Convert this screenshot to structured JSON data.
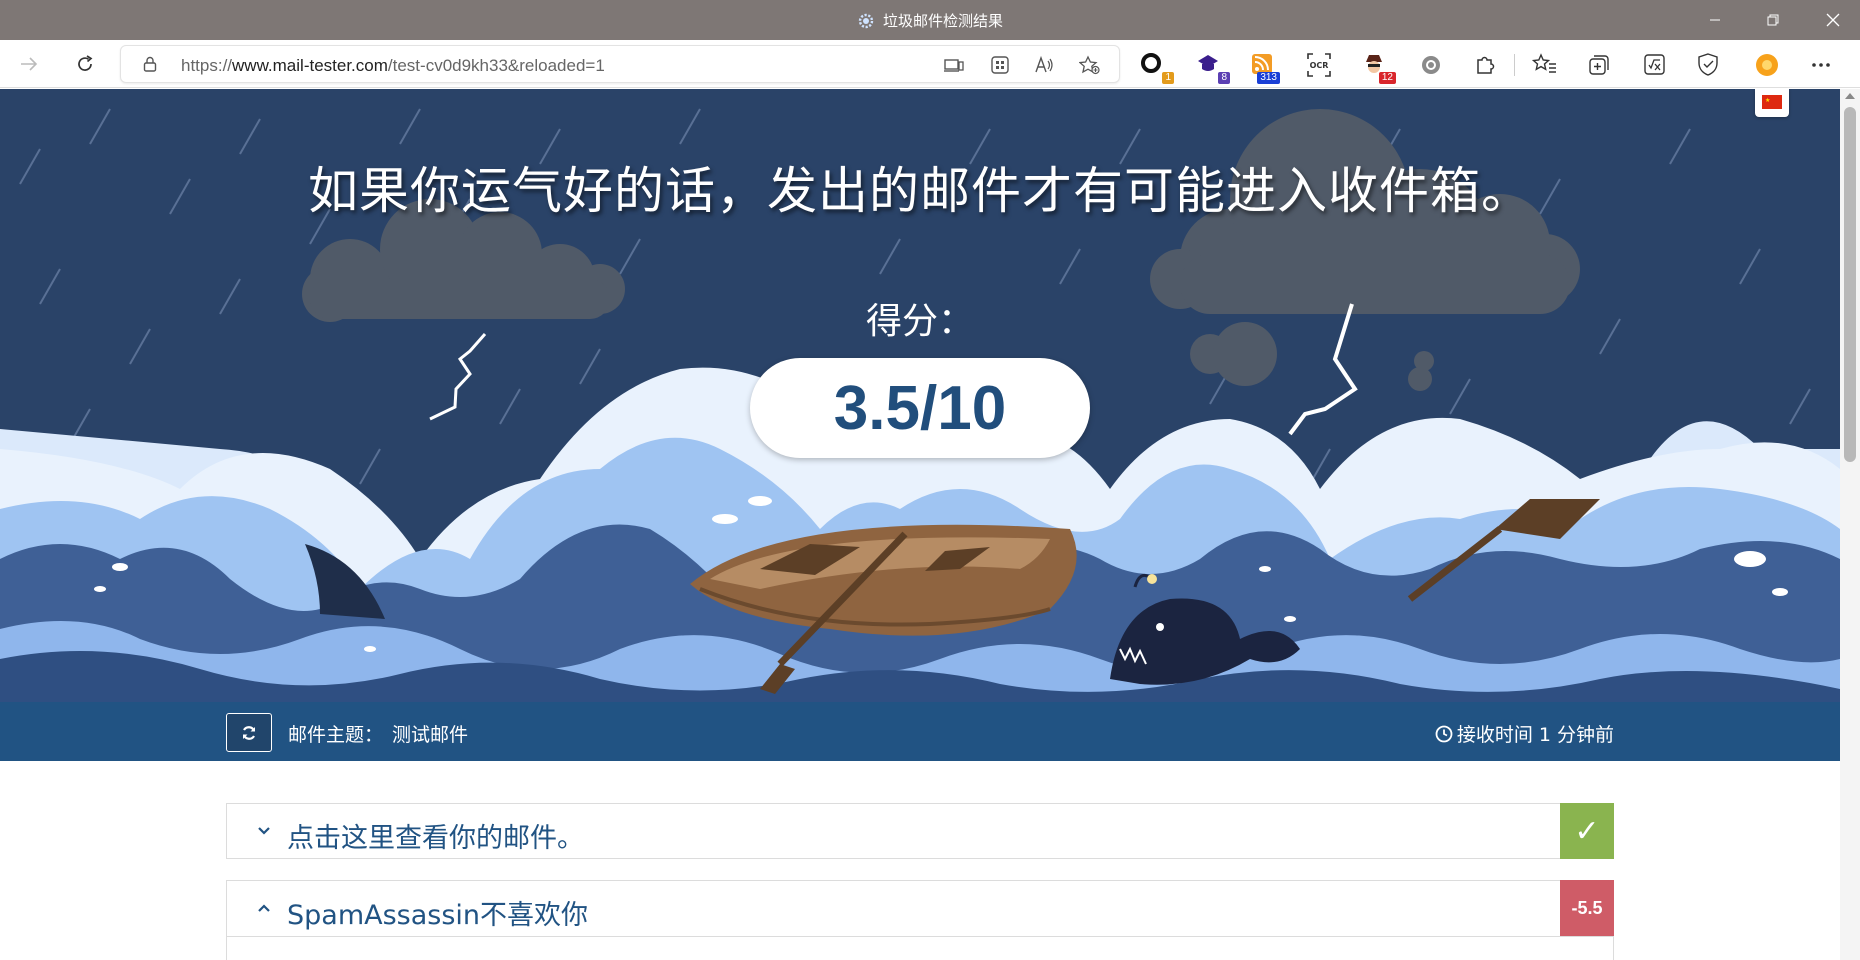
{
  "window": {
    "title": "垃圾邮件检测结果",
    "title_icon": "gear-favicon-icon",
    "controls": [
      "minimize-icon",
      "restore-icon",
      "close-icon"
    ]
  },
  "toolbar": {
    "url_prefix": "https://",
    "url_domain": "www.mail-tester.com",
    "url_path": "/test-cv0d9kh33&reloaded=1",
    "extensions": [
      {
        "name": "ext-ocr-circle",
        "badge": "1",
        "badge_color": "#e39b1c"
      },
      {
        "name": "ext-purple-hat",
        "badge": "8",
        "badge_color": "#5b3fb3"
      },
      {
        "name": "ext-rss",
        "badge": "313",
        "badge_color": "#1a3fd6"
      },
      {
        "name": "ext-ocr",
        "badge": ""
      },
      {
        "name": "ext-spy",
        "badge": "12",
        "badge_color": "#d9262c"
      },
      {
        "name": "ext-record",
        "badge": ""
      }
    ]
  },
  "hero": {
    "headline": "如果你运气好的话，发出的邮件才有可能进入收件箱。",
    "score_label": "得分：",
    "score": "3.5/10",
    "flag": "cn-flag-icon"
  },
  "subject_bar": {
    "subject_label": "邮件主题：",
    "subject_value": "测试邮件",
    "received": "接收时间 1 分钟前"
  },
  "panels": [
    {
      "title": "点击这里查看你的邮件。",
      "expanded": false,
      "score": "✓",
      "color": "#8ab44f"
    },
    {
      "title": "SpamAssassin不喜欢你",
      "expanded": true,
      "score": "-5.5",
      "color": "#cf5c67"
    }
  ]
}
